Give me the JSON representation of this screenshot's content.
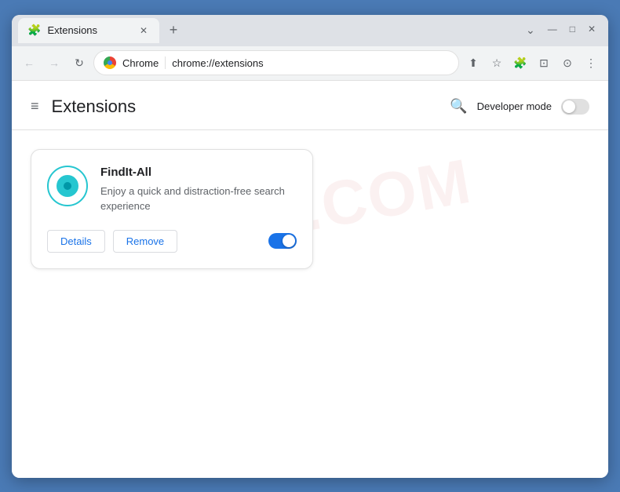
{
  "window": {
    "title": "Extensions",
    "controls": {
      "minimize": "—",
      "maximize": "□",
      "close": "✕",
      "chevron": "⌄"
    }
  },
  "tab": {
    "icon": "puzzle",
    "title": "Extensions",
    "close": "✕"
  },
  "new_tab_btn": "+",
  "toolbar": {
    "back": "←",
    "forward": "→",
    "reload": "↻",
    "chrome_label": "Chrome",
    "url": "chrome://extensions",
    "share_icon": "⬆",
    "bookmark_icon": "☆",
    "extensions_icon": "🧩",
    "tab_search_icon": "⊡",
    "profile_icon": "⊙",
    "menu_icon": "⋮"
  },
  "page": {
    "menu_icon": "≡",
    "title": "Extensions",
    "search_label": "Search",
    "developer_mode_label": "Developer mode"
  },
  "extension": {
    "name": "FindIt-All",
    "description": "Enjoy a quick and distraction-free search experience",
    "details_btn": "Details",
    "remove_btn": "Remove",
    "enabled": true
  },
  "watermark": {
    "line1": "RISK.COM"
  }
}
